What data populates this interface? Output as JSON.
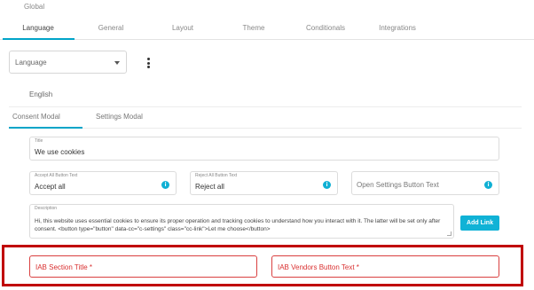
{
  "global_label": "Global",
  "main_tabs": [
    "Language",
    "General",
    "Layout",
    "Theme",
    "Conditionals",
    "Integrations"
  ],
  "language_select": {
    "value": "Language"
  },
  "language_name": "English",
  "sub_tabs": [
    "Consent Modal",
    "Settings Modal"
  ],
  "fields": {
    "title": {
      "label": "Title",
      "value": "We use cookies"
    },
    "accept_all": {
      "label": "Accept All Button Text",
      "value": "Accept all"
    },
    "reject_all": {
      "label": "Reject All Button Text",
      "value": "Reject all"
    },
    "open_settings": {
      "placeholder": "Open Settings Button Text"
    },
    "description": {
      "label": "Description",
      "value": "Hi, this website uses essential cookies to ensure its proper operation and tracking cookies to understand how you interact with it. The latter will be set only after consent. <button type=\"button\" data-cc=\"c-settings\" class=\"cc-link\">Let me choose</button>"
    },
    "iab_section_title": {
      "placeholder": "IAB Section Title *"
    },
    "iab_vendors_button": {
      "placeholder": "IAB Vendors Button Text *"
    }
  },
  "add_link_label": "Add Link",
  "colors": {
    "accent": "#00a4c8",
    "highlight": "#c00000",
    "error": "#d93030"
  }
}
